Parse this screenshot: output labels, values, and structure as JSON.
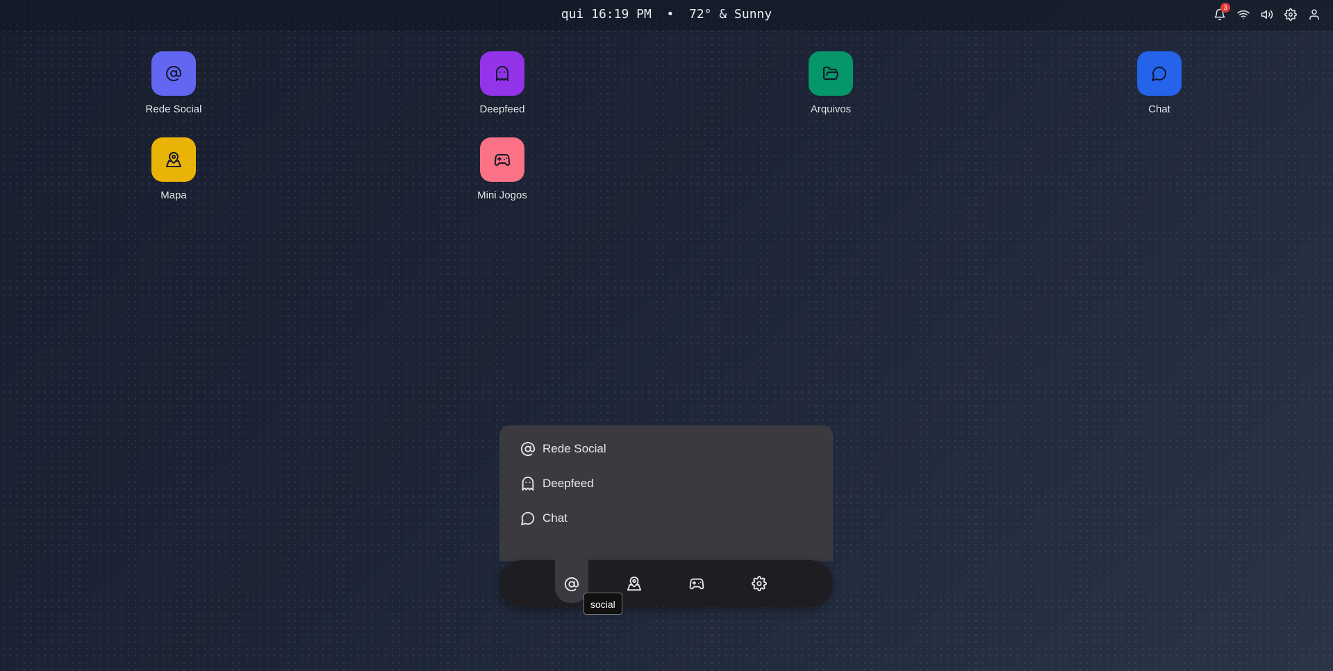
{
  "topbar": {
    "clock": "qui 16:19 PM  •  72° & Sunny",
    "notification_count": "3",
    "icons": [
      "bell-icon",
      "wifi-icon",
      "volume-icon",
      "settings-icon",
      "user-icon"
    ]
  },
  "desktop": {
    "apps": [
      {
        "label": "Rede Social",
        "icon": "at-icon",
        "color": "#6366f1"
      },
      {
        "label": "Deepfeed",
        "icon": "ghost-icon",
        "color": "#9333ea"
      },
      {
        "label": "Arquivos",
        "icon": "folder-open-icon",
        "color": "#059669"
      },
      {
        "label": "Chat",
        "icon": "message-circle-icon",
        "color": "#2563eb"
      },
      {
        "label": "Mapa",
        "icon": "map-pin-icon",
        "color": "#eab308"
      },
      {
        "label": "Mini Jogos",
        "icon": "gamepad-icon",
        "color": "#fb7185"
      }
    ]
  },
  "launcher": {
    "menu": [
      {
        "label": "Rede Social",
        "icon": "at-icon"
      },
      {
        "label": "Deepfeed",
        "icon": "ghost-icon"
      },
      {
        "label": "Chat",
        "icon": "message-circle-icon"
      }
    ],
    "dock": [
      {
        "name": "social",
        "icon": "at-icon",
        "active": true
      },
      {
        "name": "map",
        "icon": "map-pin-icon",
        "active": false
      },
      {
        "name": "games",
        "icon": "gamepad-icon",
        "active": false
      },
      {
        "name": "settings",
        "icon": "gear-icon",
        "active": false
      }
    ],
    "tooltip": "social"
  }
}
